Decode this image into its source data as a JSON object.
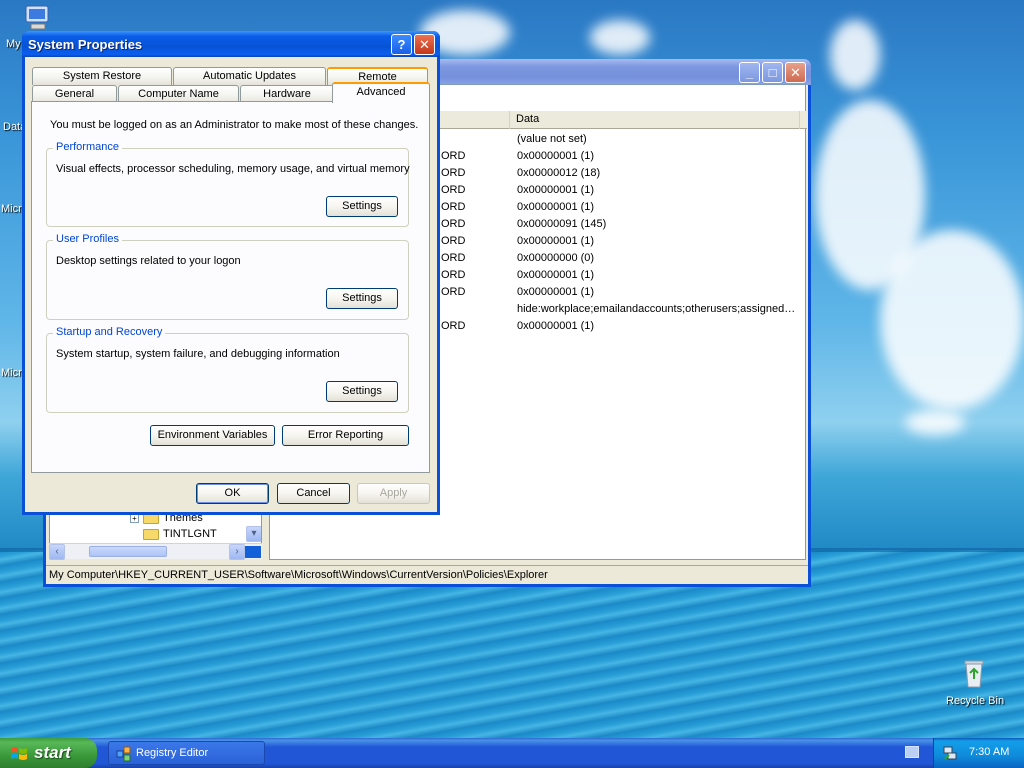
{
  "desktop": {
    "icon_labels": {
      "my_computer": "My",
      "data": "Data",
      "micro1": "Micro",
      "micro2": "Micro",
      "recycle_bin": "Recycle Bin"
    }
  },
  "registry_editor": {
    "list_headers": {
      "name": "",
      "type": "",
      "data": "Data"
    },
    "rows": [
      {
        "type": "",
        "data": "(value not set)"
      },
      {
        "type": "ORD",
        "data": "0x00000001 (1)"
      },
      {
        "type": "ORD",
        "data": "0x00000012 (18)"
      },
      {
        "type": "ORD",
        "data": "0x00000001 (1)"
      },
      {
        "type": "ORD",
        "data": "0x00000001 (1)"
      },
      {
        "type": "ORD",
        "data": "0x00000091 (145)"
      },
      {
        "type": "ORD",
        "data": "0x00000001 (1)"
      },
      {
        "type": "ORD",
        "data": "0x00000000 (0)"
      },
      {
        "type": "ORD",
        "data": "0x00000001 (1)"
      },
      {
        "type": "ORD",
        "data": "0x00000001 (1)"
      },
      {
        "type": "",
        "data": "hide:workplace;emailandaccounts;otherusers;assigned…"
      },
      {
        "type": "ORD",
        "data": "0x00000001 (1)"
      }
    ],
    "tree": [
      {
        "label": "Themes"
      },
      {
        "label": "TINTLGNT"
      }
    ],
    "status_path": "My Computer\\HKEY_CURRENT_USER\\Software\\Microsoft\\Windows\\CurrentVersion\\Policies\\Explorer"
  },
  "system_properties": {
    "title": "System Properties",
    "tabs_back": [
      "System Restore",
      "Automatic Updates",
      "Remote"
    ],
    "tabs_front": [
      "General",
      "Computer Name",
      "Hardware",
      "Advanced"
    ],
    "active_tab": "Advanced",
    "admin_note": "You must be logged on as an Administrator to make most of these changes.",
    "groups": [
      {
        "title": "Performance",
        "text": "Visual effects, processor scheduling, memory usage, and virtual memory",
        "button": "Settings"
      },
      {
        "title": "User Profiles",
        "text": "Desktop settings related to your logon",
        "button": "Settings"
      },
      {
        "title": "Startup and Recovery",
        "text": "System startup, system failure, and debugging information",
        "button": "Settings"
      }
    ],
    "env_button": "Environment Variables",
    "error_button": "Error Reporting",
    "ok": "OK",
    "cancel": "Cancel",
    "apply": "Apply"
  },
  "taskbar": {
    "start_label": "start",
    "task_label": "Registry Editor",
    "clock": "7:30 AM"
  }
}
